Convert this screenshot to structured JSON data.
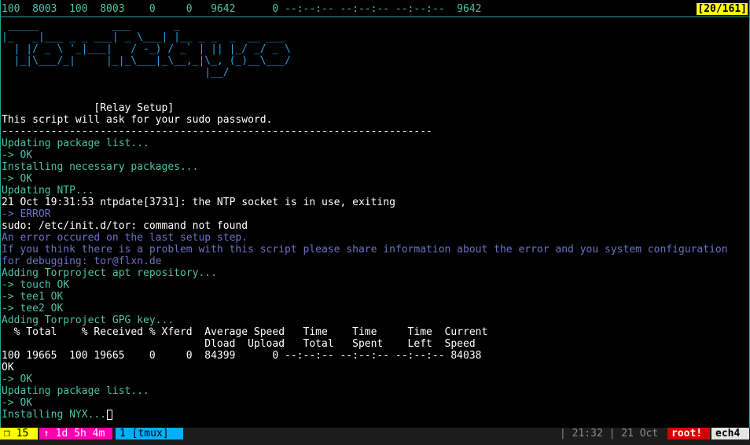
{
  "pane_top": {
    "progress_line": "100  8003  100  8003    0     0   9642      0 --:--:-- --:--:-- --:--:--  9642",
    "pane_indicator": "[20/161]"
  },
  "banner_lines": [
    " _____            ___       _",
    "|_   _|___ _ _ ___| _ \\___| |__ _ _  _  __ ___",
    "  | |/ _ \\ '_|___|   / -_) / _` | || |_/ _/ _ \\",
    "  |_|\\___/_|     |_|_\\___|_\\__,_|\\_, (_)__\\___/",
    "                                 |__/"
  ],
  "terminal_lines": [
    {
      "text": "",
      "color": "white"
    },
    {
      "text": "",
      "color": "white"
    },
    {
      "text": "               [Relay Setup]",
      "color": "white"
    },
    {
      "text": "This script will ask for your sudo password.",
      "color": "white"
    },
    {
      "text": "----------------------------------------------------------------------",
      "color": "white"
    },
    {
      "text": "Updating package list...",
      "color": "teal"
    },
    {
      "text": "-> OK",
      "color": "teal"
    },
    {
      "text": "Installing necessary packages...",
      "color": "teal"
    },
    {
      "text": "-> OK",
      "color": "teal"
    },
    {
      "text": "Updating NTP...",
      "color": "teal"
    },
    {
      "text": "21 Oct 19:31:53 ntpdate[3731]: the NTP socket is in use, exiting",
      "color": "white"
    },
    {
      "text": "-> ERROR",
      "color": "purple"
    },
    {
      "text": "sudo: /etc/init.d/tor: command not found",
      "color": "white"
    },
    {
      "text": "An error occured on the last setup step.",
      "color": "purple"
    },
    {
      "text": "If you think there is a problem with this script please share information about the error and you system configuration",
      "color": "purple"
    },
    {
      "text": "for debugging: tor@flxn.de",
      "color": "purple"
    },
    {
      "text": "Adding Torproject apt repository...",
      "color": "teal"
    },
    {
      "text": "-> touch OK",
      "color": "teal"
    },
    {
      "text": "-> tee1 OK",
      "color": "teal"
    },
    {
      "text": "-> tee2 OK",
      "color": "teal"
    },
    {
      "text": "Adding Torproject GPG key...",
      "color": "teal"
    },
    {
      "text": "  % Total    % Received % Xferd  Average Speed   Time    Time     Time  Current",
      "color": "white"
    },
    {
      "text": "                                 Dload  Upload   Total   Spent    Left  Speed",
      "color": "white"
    },
    {
      "text": "100 19665  100 19665    0     0  84399      0 --:--:-- --:--:-- --:--:-- 84038",
      "color": "white"
    },
    {
      "text": "OK",
      "color": "white"
    },
    {
      "text": "-> OK",
      "color": "teal"
    },
    {
      "text": "Updating package list...",
      "color": "teal"
    },
    {
      "text": "-> OK",
      "color": "teal"
    }
  ],
  "prompt_line": "Installing NYX...",
  "status_bar": {
    "session": "❒ 15",
    "uptime": "↑ 1d 5h 4m",
    "window": "1 [tmux]",
    "clock": "| 21:32 | 21 Oct",
    "root": "root!",
    "host": "ech4"
  },
  "colors": {
    "teal": "#49c4a4",
    "purple": "#6c71c4",
    "banner": "#2aa0d8",
    "white": "#ffffff",
    "pane_border": "#2aa198",
    "session_bg": "#ffff00",
    "uptime_bg": "#ff00af",
    "window_bg": "#00afff",
    "root_bg": "#d70000",
    "host_bg": "#e4e4e4"
  }
}
